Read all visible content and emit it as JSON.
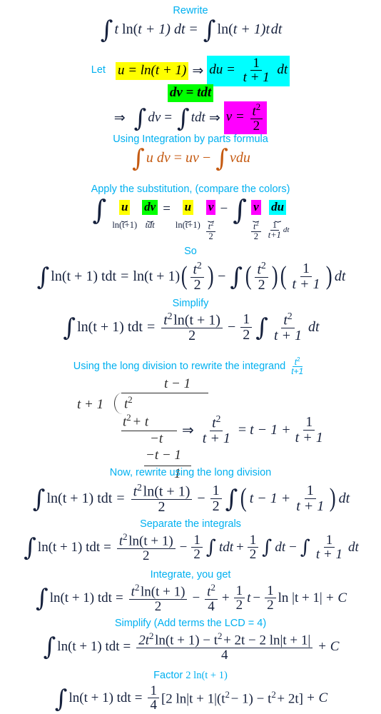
{
  "headings": {
    "rewrite": "Rewrite",
    "let": "Let",
    "ibp": "Using Integration by parts formula",
    "apply": "Apply the substitution, (compare the colors)",
    "so": "So",
    "simplify": "Simplify",
    "long_division": "Using the long division to rewrite the integrand",
    "now_rewrite": "Now, rewrite using the long division",
    "separate": "Separate the integrals",
    "integrate": "Integrate, you get",
    "simplify_lcd": "Simplify (Add terms the LCD = 4)",
    "factor": "Factor"
  },
  "colors": {
    "heading": "#00b0f0",
    "math": "#16213d",
    "ibp_formula": "#c55a11",
    "highlight_u": "#ffff00",
    "highlight_du": "#00ffff",
    "highlight_dv": "#00ff00",
    "highlight_v": "#ff00ff",
    "long_division": "#2b2b2b"
  },
  "eq_rewrite": {
    "lhs_t": "t",
    "lhs_ln": "ln(",
    "lhs_tp1": "t + 1)",
    "lhs_dt": "dt",
    "eq": "=",
    "rhs_ln": "ln(",
    "rhs_tp1": "t + 1)",
    "rhs_t": "t",
    "rhs_dt": "dt"
  },
  "substitution": {
    "u_def": "u = ln(t + 1)",
    "implies": "⇒",
    "du_lhs": "du =",
    "du_num": "1",
    "du_den": "t + 1",
    "du_dt": "dt",
    "dv_def": "dv = tdt",
    "int_dv": "dv",
    "eq": "=",
    "int_tdt": "tdt",
    "v_lhs": "v =",
    "v_num": "t",
    "v_num_sup": "2",
    "v_den": "2"
  },
  "ibp_formula": {
    "u": "u",
    "dv": "dv",
    "eq": "=",
    "uv": "uv",
    "minus": "−",
    "vdu": "vdu"
  },
  "color_sub": {
    "u1": {
      "top": "u",
      "bottom": "ln(t+1)"
    },
    "dv": {
      "top": "dv",
      "bottom": "tdt"
    },
    "eq": "=",
    "u2": {
      "top": "u",
      "bottom": "ln(t+1)"
    },
    "v1": {
      "top": "v",
      "bottom_num": "t",
      "bottom_sup": "2",
      "bottom_den": "2"
    },
    "minus": "−",
    "v2": {
      "top": "v",
      "bottom_num": "t",
      "bottom_sup": "2",
      "bottom_den": "2"
    },
    "du": {
      "top": "du",
      "bottom_num": "1",
      "bottom_den": "t+1",
      "suffix": "dt"
    }
  },
  "eq_so": {
    "lhs": "ln(t + 1) tdt",
    "eq": "=",
    "ln_factor": "ln(t + 1)",
    "f1_num": "t",
    "f1_sup": "2",
    "f1_den": "2",
    "minus": "−",
    "f2_num": "t",
    "f2_sup": "2",
    "f2_den": "2",
    "f3_num": "1",
    "f3_den": "t + 1",
    "dt": "dt"
  },
  "eq_simplify": {
    "lhs": "ln(t + 1) tdt",
    "eq": "=",
    "num_t": "t",
    "num_sup": "2",
    "num_ln": "ln(t + 1)",
    "den": "2",
    "minus": "−",
    "half_num": "1",
    "half_den": "2",
    "f_num": "t",
    "f_sup": "2",
    "f_den": "t + 1",
    "dt": "dt"
  },
  "long_division": {
    "integrand_num": "t",
    "integrand_sup": "2",
    "integrand_den": "t+1",
    "quotient": "t − 1",
    "divisor": "t + 1",
    "dividend": "t",
    "dividend_sup": "2",
    "step1": "t",
    "step1_sup": "2",
    "step1_rest": "+ t",
    "remainder1": "−t",
    "step2": "−t − 1",
    "remainder2": "1",
    "implies": "⇒",
    "result_num": "t",
    "result_sup": "2",
    "result_den": "t + 1",
    "result_eq": "=",
    "result_poly": "t − 1 +",
    "result_frac_num": "1",
    "result_frac_den": "t + 1"
  },
  "eq_now_rewrite": {
    "lhs": "ln(t + 1) tdt",
    "eq": "=",
    "num_t": "t",
    "num_sup": "2",
    "num_ln": "ln(t + 1)",
    "den": "2",
    "minus": "−",
    "half_num": "1",
    "half_den": "2",
    "inner": "t − 1 +",
    "inner_num": "1",
    "inner_den": "t + 1",
    "dt": "dt"
  },
  "eq_separate": {
    "lhs": "ln(t + 1) tdt",
    "eq": "=",
    "num_t": "t",
    "num_sup": "2",
    "num_ln": "ln(t + 1)",
    "den": "2",
    "minus1": "−",
    "half1_num": "1",
    "half1_den": "2",
    "tdt": "tdt",
    "plus": "+",
    "half2_num": "1",
    "half2_den": "2",
    "dt1": "dt",
    "minus2": "−",
    "f_num": "1",
    "f_den": "t + 1",
    "dt2": "dt"
  },
  "eq_integrate": {
    "lhs": "ln(t + 1) tdt",
    "eq": "=",
    "num_t": "t",
    "num_sup": "2",
    "num_ln": "ln(t + 1)",
    "den": "2",
    "minus1": "−",
    "t2_num": "t",
    "t2_sup": "2",
    "t2_den": "4",
    "plus": "+",
    "half1_num": "1",
    "half1_den": "2",
    "t_var": "t",
    "minus2": "−",
    "half2_num": "1",
    "half2_den": "2",
    "ln_abs": "ln |t + 1|",
    "plus_c": "+ C"
  },
  "eq_lcd": {
    "lhs": "ln(t + 1) tdt",
    "eq": "=",
    "num": "2t² ln(t + 1) − t² + 2t − 2 ln|t + 1|",
    "num_a": "2t",
    "num_a_sup": "2",
    "num_b": "ln(t + 1) − t",
    "num_b_sup": "2",
    "num_c": "+ 2t − 2 ln|t + 1|",
    "den": "4",
    "plus_c": "+ C"
  },
  "eq_factor": {
    "heading_math": "2 ln(t + 1)",
    "lhs": "ln(t + 1) tdt",
    "eq": "=",
    "frac_num": "1",
    "frac_den": "4",
    "body_a": "[2 ln|t + 1|(t",
    "body_a_sup": "2",
    "body_b": "− 1) − t",
    "body_b_sup": "2",
    "body_c": "+ 2t]",
    "plus_c": "+ C"
  }
}
